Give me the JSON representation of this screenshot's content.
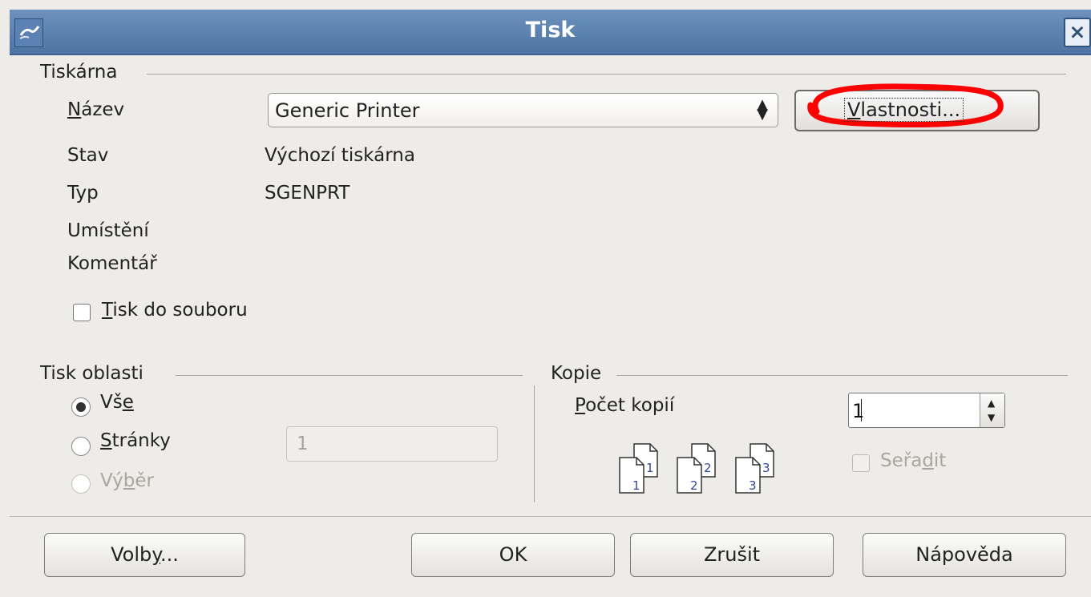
{
  "window": {
    "title": "Tisk",
    "close_label": "×",
    "icon_name": "app-window-icon"
  },
  "printer_section": {
    "title": "Tiskárna",
    "name_label_prefix": "",
    "name_label_mnemonic": "N",
    "name_label_rest": "ázev",
    "printer_name": "Generic Printer",
    "properties_button_label_mnemonic": "V",
    "properties_button_label_rest": "lastnosti...",
    "status_label": "Stav",
    "status_value": "Výchozí tiskárna",
    "type_label": "Typ",
    "type_value": "SGENPRT",
    "location_label": "Umístění",
    "comment_label": "Komentář",
    "print_to_file_mnemonic": "T",
    "print_to_file_rest": "isk do souboru",
    "highlight_color": "#ff0000"
  },
  "range_section": {
    "title": "Tisk oblasti",
    "all_label_prefix": "Vš",
    "all_label_mnemonic": "e",
    "pages_mnemonic": "S",
    "pages_rest": "tránky",
    "pages_value": "1",
    "selection_label_prefix": "Vý",
    "selection_label_mnemonic": "b",
    "selection_label_rest": "ěr",
    "selected_option": "Vše"
  },
  "copies_section": {
    "title": "Kopie",
    "count_label_mnemonic": "P",
    "count_label_rest": "očet kopií",
    "count_value": "1",
    "collate_label_prefix": "Seřa",
    "collate_label_mnemonic": "d",
    "collate_label_rest": "it",
    "copy_icons": [
      {
        "back": "1",
        "front": "1"
      },
      {
        "back": "2",
        "front": "2"
      },
      {
        "back": "3",
        "front": "3"
      }
    ]
  },
  "buttons": {
    "options_prefix": "Volb",
    "options_mnemonic": "y",
    "options_rest": "...",
    "ok": "OK",
    "cancel": "Zrušit",
    "help": "Nápověda"
  }
}
